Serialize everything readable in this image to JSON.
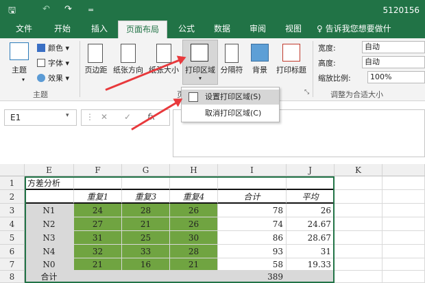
{
  "titlebar": {
    "file_name": "5120156",
    "save_glyph": "🖫",
    "undo_glyph": "↶",
    "redo_glyph": "↷",
    "customize_glyph": "="
  },
  "tabs": [
    {
      "label": "文件"
    },
    {
      "label": "开始"
    },
    {
      "label": "插入"
    },
    {
      "label": "页面布局"
    },
    {
      "label": "公式"
    },
    {
      "label": "数据"
    },
    {
      "label": "审阅"
    },
    {
      "label": "视图"
    },
    {
      "label": "♀ 告诉我您想要做什"
    }
  ],
  "ribbon": {
    "theme": {
      "main": "主题",
      "colors": "颜色 ▾",
      "fonts": "字体 ▾",
      "effects": "效果 ▾",
      "group": "主题"
    },
    "page_setup": {
      "margins": "页边距",
      "orientation": "纸张方向",
      "size": "纸张大小",
      "print_area": "打印区域",
      "breaks": "分隔符",
      "background": "背景",
      "print_titles": "打印标题",
      "group": "页",
      "launcher": "⤡"
    },
    "scale": {
      "width_label": "宽度:",
      "width_value": "自动",
      "height_label": "高度:",
      "height_value": "自动",
      "scale_label": "缩放比例:",
      "scale_value": "100%",
      "group": "调整为合适大小"
    }
  },
  "dropdown": {
    "set_print_area": "设置打印区域(S)",
    "clear_print_area": "取消打印区域(C)"
  },
  "formula": {
    "namebox": "E1",
    "namebox_arrow": "▾",
    "cancel": "✕",
    "enter": "✓",
    "fx": "fx",
    "more": "⋮"
  },
  "sheet": {
    "columns": [
      "E",
      "F",
      "G",
      "H",
      "I",
      "J",
      "K"
    ],
    "rows": [
      "1",
      "2",
      "3",
      "4",
      "5",
      "6",
      "7",
      "8"
    ],
    "title": "方差分析",
    "header": [
      "",
      "重复1",
      "重复3",
      "重复4",
      "合计",
      "平均"
    ],
    "data": [
      [
        "N1",
        "24",
        "28",
        "26",
        "78",
        "26"
      ],
      [
        "N2",
        "27",
        "21",
        "26",
        "74",
        "24.67"
      ],
      [
        "N3",
        "31",
        "25",
        "30",
        "86",
        "28.67"
      ],
      [
        "N4",
        "32",
        "33",
        "28",
        "93",
        "31"
      ],
      [
        "N0",
        "21",
        "16",
        "21",
        "58",
        "19.33"
      ]
    ],
    "total_label": "合计",
    "total_value": "389"
  },
  "colors": {
    "accent": "#217346",
    "green_cell": "#70a441",
    "arrow": "#e8393c"
  }
}
